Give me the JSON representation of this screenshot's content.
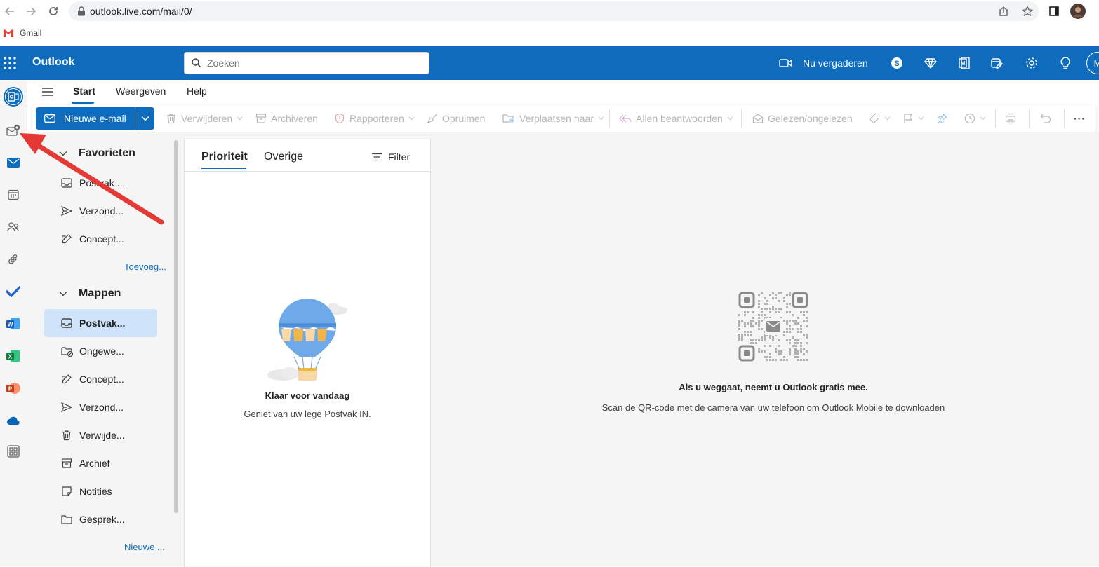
{
  "browser": {
    "url": "outlook.live.com/mail/0/",
    "bookmark_gmail": "Gmail"
  },
  "header": {
    "app_title": "Outlook",
    "search_placeholder": "Zoeken",
    "meet_now_label": "Nu vergaderen",
    "avatar_initial": "M"
  },
  "ribbon_tabs": [
    "Start",
    "Weergeven",
    "Help"
  ],
  "ribbon": {
    "new_mail": "Nieuwe e-mail",
    "delete": "Verwijderen",
    "archive": "Archiveren",
    "report": "Rapporteren",
    "sweep": "Opruimen",
    "move_to": "Verplaatsen naar",
    "reply_all": "Allen beantwoorden",
    "read_unread": "Gelezen/ongelezen",
    "more": "···"
  },
  "folder_pane": {
    "favorites_title": "Favorieten",
    "favorites": [
      {
        "label": "Postvak ..."
      },
      {
        "label": "Verzond..."
      },
      {
        "label": "Concept..."
      }
    ],
    "add_favorite": "Toevoeg...",
    "folders_title": "Mappen",
    "folders": [
      {
        "label": "Postvak..."
      },
      {
        "label": "Ongewe..."
      },
      {
        "label": "Concept..."
      },
      {
        "label": "Verzond..."
      },
      {
        "label": "Verwijde..."
      },
      {
        "label": "Archief"
      },
      {
        "label": "Notities"
      },
      {
        "label": "Gesprek..."
      }
    ],
    "new_folder": "Nieuwe ..."
  },
  "message_list": {
    "tab_focused": "Prioriteit",
    "tab_other": "Overige",
    "filter_label": "Filter",
    "empty_title": "Klaar voor vandaag",
    "empty_subtitle": "Geniet van uw lege Postvak IN."
  },
  "reading_pane": {
    "title": "Als u weggaat, neemt u Outlook gratis mee.",
    "subtitle": "Scan de QR-code met de camera van uw telefoon om Outlook Mobile te downloaden"
  },
  "colors": {
    "brand": "#0f6cbd",
    "selected": "#cfe4fa",
    "arrow": "#e53935"
  }
}
